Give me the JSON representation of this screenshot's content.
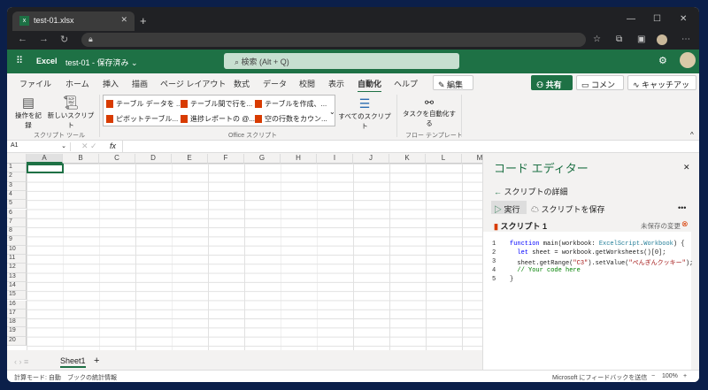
{
  "browser": {
    "tab_title": "test-01.xlsx",
    "new_tab": "+",
    "minimize": "—",
    "maximize": "☐",
    "close": "✕"
  },
  "excel": {
    "app": "Excel",
    "doc_title": "test-01 - 保存済み ⌄",
    "search": "検索 (Alt + Q)"
  },
  "ribbon_tabs": [
    "ファイル",
    "ホーム",
    "挿入",
    "描画",
    "ページ レイアウト",
    "数式",
    "データ",
    "校閲",
    "表示",
    "自動化",
    "ヘルプ"
  ],
  "edit_button": "✎ 編集 ⌄",
  "share_button": "共有 ⌄",
  "comment_button": "コメント",
  "catchup_button": "キャッチアップ",
  "ribbon": {
    "record": "操作を記録",
    "new_script": "新しいスクリプト",
    "group_tools": "スクリプト ツール",
    "gallery": [
      "テーブル データを ...",
      "テーブル間で行を...",
      "テーブルを作成、...",
      "ピボットテーブル...",
      "進捗レポートの @...",
      "空の行数をカウン..."
    ],
    "group_office": "Office スクリプト",
    "all_scripts": "すべてのスクリプト",
    "automate": "タスクを自動化する",
    "group_flow": "フロー テンプレート"
  },
  "formula_bar": {
    "name_box": "A1",
    "fx": "fx"
  },
  "columns": [
    "A",
    "B",
    "C",
    "D",
    "E",
    "F",
    "G",
    "H",
    "I",
    "J",
    "K",
    "L",
    "M"
  ],
  "rows": [
    "1",
    "2",
    "3",
    "4",
    "5",
    "6",
    "7",
    "8",
    "9",
    "10",
    "11",
    "12",
    "13",
    "14",
    "15",
    "16",
    "17",
    "18",
    "19",
    "20"
  ],
  "sheet_tab": "Sheet1",
  "editor": {
    "title": "コード エディター",
    "back": "スクリプトの詳細",
    "run": "実行",
    "save": "スクリプトを保存",
    "more": "•••",
    "script_name": "スクリプト 1",
    "unsaved": "未保存の変更",
    "line_numbers": [
      "1",
      "2",
      "3",
      "4",
      "5"
    ]
  },
  "status": {
    "calc_mode": "計算モード: 自動",
    "stats": "ブックの統計情報",
    "feedback": "Microsoft にフィードバックを送信",
    "zoom": "100%"
  }
}
